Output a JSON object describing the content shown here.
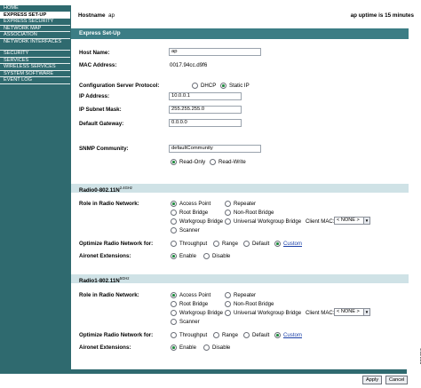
{
  "nav": {
    "items": [
      {
        "label": "HOME",
        "selected": false
      },
      {
        "label": "EXPRESS SET-UP",
        "selected": true
      },
      {
        "label": "EXPRESS SECURITY",
        "selected": false
      },
      {
        "label": "NETWORK MAP",
        "selected": false
      },
      {
        "label": "ASSOCIATION",
        "selected": false
      },
      {
        "label": "NETWORK INTERFACES",
        "selected": false
      },
      {
        "label": "SECURITY",
        "selected": false
      },
      {
        "label": "SERVICES",
        "selected": false
      },
      {
        "label": "WIRELESS SERVICES",
        "selected": false
      },
      {
        "label": "SYSTEM SOFTWARE",
        "selected": false
      },
      {
        "label": "EVENT LOG",
        "selected": false
      }
    ]
  },
  "header": {
    "hostname_label": "Hostname",
    "hostname_value": "ap",
    "uptime": "ap uptime is 15 minutes"
  },
  "page_title": "Express Set-Up",
  "general": {
    "host_name_label": "Host Name:",
    "host_name_value": "ap",
    "mac_label": "MAC Address:",
    "mac_value": "0017.94cc.d9f6",
    "config_protocol_label": "Configuration Server Protocol:",
    "dhcp_label": "DHCP",
    "static_label": "Static IP",
    "ip_label": "IP Address:",
    "ip_value": "10.0.0.1",
    "subnet_label": "IP Subnet Mask:",
    "subnet_value": "255.255.255.0",
    "gateway_label": "Default Gateway:",
    "gateway_value": "0.0.0.0",
    "snmp_label": "SNMP Community:",
    "snmp_value": "defaultCommunity",
    "readonly_label": "Read-Only",
    "readwrite_label": "Read-Write"
  },
  "radios": [
    {
      "title": "Radio0-802.11N",
      "band": "2.4GHz",
      "role_label": "Role in Radio Network:",
      "roles": [
        "Access Point",
        "Repeater",
        "Root Bridge",
        "Non-Root Bridge",
        "Workgroup Bridge",
        "Universal Workgroup Bridge",
        "Scanner"
      ],
      "client_mac_label": "Client MAC:",
      "client_mac_value": "< NONE >",
      "optimize_label": "Optimize Radio Network for:",
      "optimize_options": [
        "Throughput",
        "Range",
        "Default",
        "Custom"
      ],
      "aironet_label": "Aironet Extensions:",
      "aironet_options": [
        "Enable",
        "Disable"
      ]
    },
    {
      "title": "Radio1-802.11N",
      "band": "5GHz",
      "role_label": "Role in Radio Network:",
      "roles": [
        "Access Point",
        "Repeater",
        "Root Bridge",
        "Non-Root Bridge",
        "Workgroup Bridge",
        "Universal Workgroup Bridge",
        "Scanner"
      ],
      "client_mac_label": "Client MAC:",
      "client_mac_value": "< NONE >",
      "optimize_label": "Optimize Radio Network for:",
      "optimize_options": [
        "Throughput",
        "Range",
        "Default",
        "Custom"
      ],
      "aironet_label": "Aironet Extensions:",
      "aironet_options": [
        "Enable",
        "Disable"
      ]
    }
  ],
  "buttons": {
    "apply": "Apply",
    "cancel": "Cancel"
  },
  "figure_id": "231719",
  "colors": {
    "nav_bg": "#2f6a6f",
    "title_bar": "#3c7d85",
    "section_bar": "#cfe2e6",
    "radio_selected": "#1f8a3e",
    "link": "#1a3fa8"
  }
}
